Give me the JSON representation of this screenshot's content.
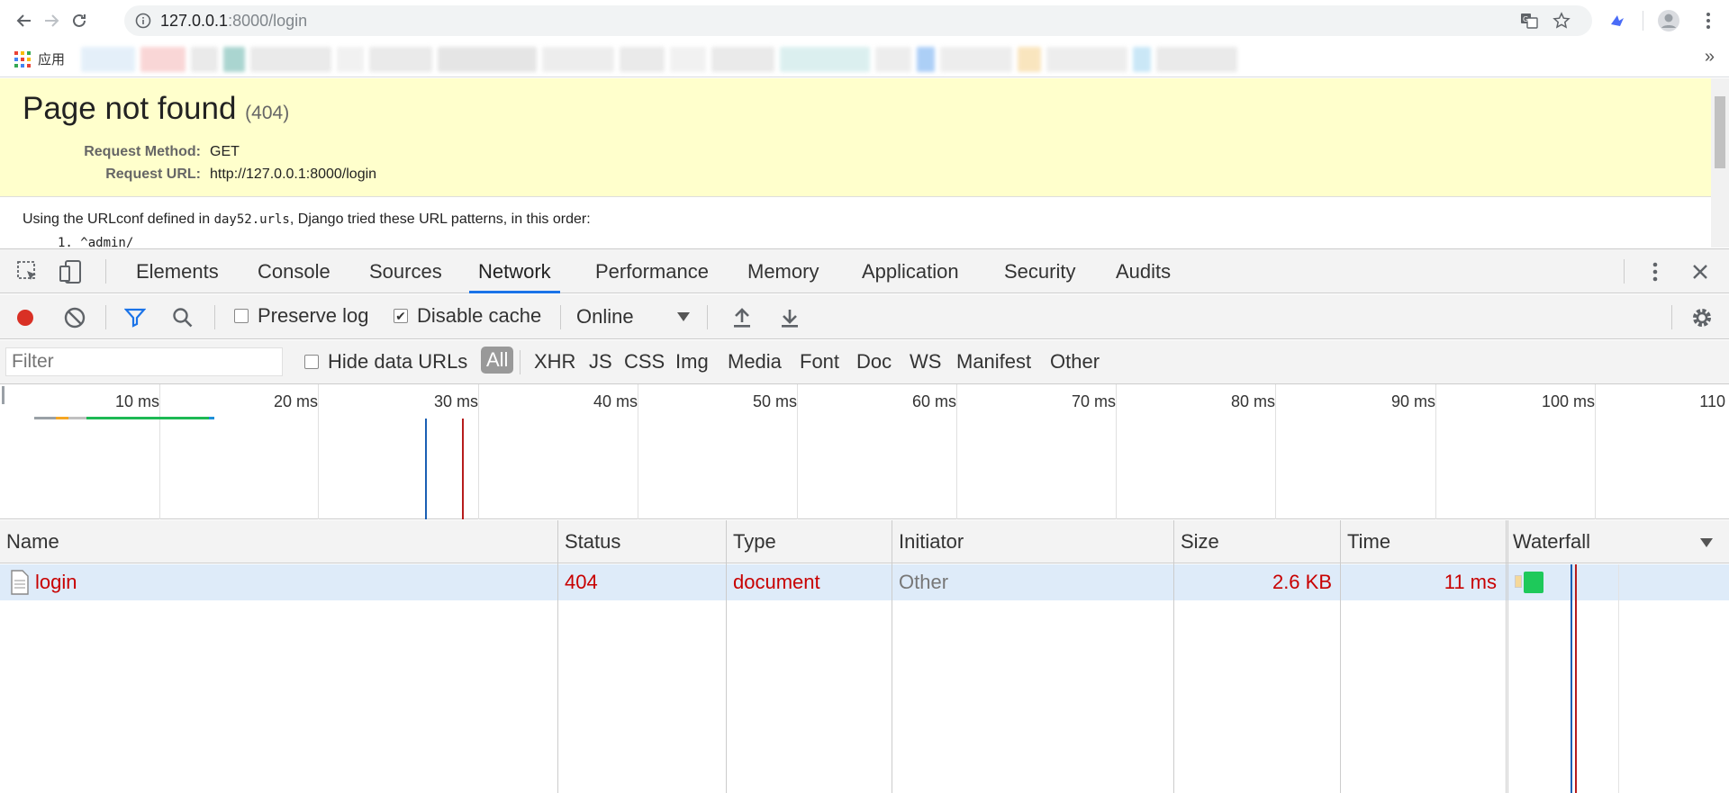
{
  "browser": {
    "url_host": "127.0.0.1",
    "url_rest": ":8000/login",
    "bookmarks_apps_label": "应用",
    "bookmarks_more": "»"
  },
  "page": {
    "title": "Page not found",
    "status_code": "(404)",
    "request_method_label": "Request Method:",
    "request_method": "GET",
    "request_url_label": "Request URL:",
    "request_url": "http://127.0.0.1:8000/login",
    "info_pre": "Using the URLconf defined in ",
    "info_module": "day52.urls",
    "info_post": ", Django tried these URL patterns, in this order:",
    "pattern_1": "1.   ^admin/"
  },
  "devtools": {
    "tabs": [
      "Elements",
      "Console",
      "Sources",
      "Network",
      "Performance",
      "Memory",
      "Application",
      "Security",
      "Audits"
    ],
    "active_tab": "Network",
    "toolbar": {
      "preserve_log": "Preserve log",
      "disable_cache": "Disable cache",
      "throttling": "Online"
    },
    "filter": {
      "placeholder": "Filter",
      "hide_data_urls": "Hide data URLs",
      "types": [
        "All",
        "XHR",
        "JS",
        "CSS",
        "Img",
        "Media",
        "Font",
        "Doc",
        "WS",
        "Manifest",
        "Other"
      ],
      "selected_type": "All"
    },
    "overview": {
      "ticks": [
        "10 ms",
        "20 ms",
        "30 ms",
        "40 ms",
        "50 ms",
        "60 ms",
        "70 ms",
        "80 ms",
        "90 ms",
        "100 ms",
        "110"
      ]
    },
    "columns": [
      "Name",
      "Status",
      "Type",
      "Initiator",
      "Size",
      "Time",
      "Waterfall"
    ],
    "rows": [
      {
        "name": "login",
        "status": "404",
        "type": "document",
        "initiator": "Other",
        "size": "2.6 KB",
        "time": "11 ms"
      }
    ]
  },
  "colors": {
    "error_text": "#c80000",
    "selected_row": "#deebf9",
    "django_summary": "#ffffcc",
    "active_tab_underline": "#1a73e8",
    "record_red": "#d93025",
    "filter_blue": "#1a73e8",
    "dom_content_loaded_line": "#1a5fb4",
    "load_line": "#b71c1c"
  }
}
